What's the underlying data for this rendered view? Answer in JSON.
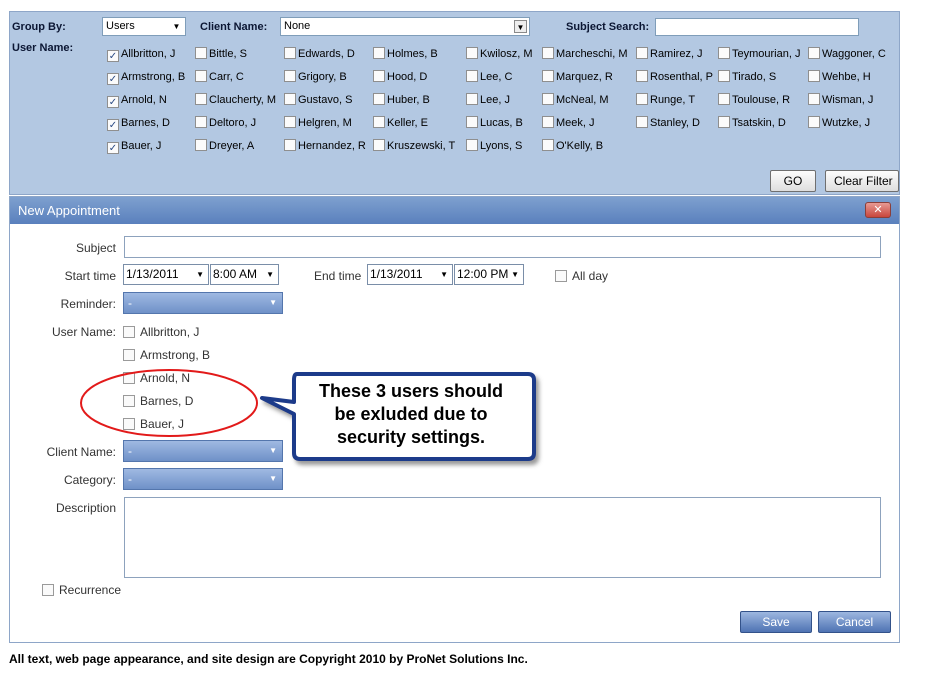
{
  "filter": {
    "group_by_label": "Group By:",
    "group_by_value": "Users",
    "client_name_label": "Client Name:",
    "client_name_value": "None",
    "subject_search_label": "Subject Search:",
    "subject_search_value": "",
    "user_name_label": "User Name:",
    "go_label": "GO",
    "clear_label": "Clear Filter",
    "users": [
      {
        "name": "Allbritton, J",
        "checked": true
      },
      {
        "name": "Armstrong, B",
        "checked": true
      },
      {
        "name": "Arnold, N",
        "checked": true
      },
      {
        "name": "Barnes, D",
        "checked": true
      },
      {
        "name": "Bauer, J",
        "checked": true
      },
      {
        "name": "Bittle, S",
        "checked": false
      },
      {
        "name": "Carr, C",
        "checked": false
      },
      {
        "name": "Claucherty, M",
        "checked": false
      },
      {
        "name": "Deltoro, J",
        "checked": false
      },
      {
        "name": "Dreyer, A",
        "checked": false
      },
      {
        "name": "Edwards, D",
        "checked": false
      },
      {
        "name": "Grigory, B",
        "checked": false
      },
      {
        "name": "Gustavo, S",
        "checked": false
      },
      {
        "name": "Helgren, M",
        "checked": false
      },
      {
        "name": "Hernandez, R",
        "checked": false
      },
      {
        "name": "Holmes, B",
        "checked": false
      },
      {
        "name": "Hood, D",
        "checked": false
      },
      {
        "name": "Huber, B",
        "checked": false
      },
      {
        "name": "Keller, E",
        "checked": false
      },
      {
        "name": "Kruszewski, T",
        "checked": false
      },
      {
        "name": "Kwilosz, M",
        "checked": false
      },
      {
        "name": "Lee, C",
        "checked": false
      },
      {
        "name": "Lee, J",
        "checked": false
      },
      {
        "name": "Lucas, B",
        "checked": false
      },
      {
        "name": "Lyons, S",
        "checked": false
      },
      {
        "name": "Marcheschi, M",
        "checked": false
      },
      {
        "name": "Marquez, R",
        "checked": false
      },
      {
        "name": "McNeal, M",
        "checked": false
      },
      {
        "name": "Meek, J",
        "checked": false
      },
      {
        "name": "O'Kelly, B",
        "checked": false
      },
      {
        "name": "Ramirez, J",
        "checked": false
      },
      {
        "name": "Rosenthal, P",
        "checked": false
      },
      {
        "name": "Runge, T",
        "checked": false
      },
      {
        "name": "Stanley, D",
        "checked": false
      },
      {
        "name": "Teymourian, J",
        "checked": false
      },
      {
        "name": "Tirado, S",
        "checked": false
      },
      {
        "name": "Toulouse, R",
        "checked": false
      },
      {
        "name": "Tsatskin, D",
        "checked": false
      },
      {
        "name": "Waggoner, C",
        "checked": false
      },
      {
        "name": "Wehbe, H",
        "checked": false
      },
      {
        "name": "Wisman, J",
        "checked": false
      },
      {
        "name": "Wutzke, J",
        "checked": false
      }
    ]
  },
  "dialog": {
    "title": "New Appointment",
    "close_icon": "close-x",
    "subject_label": "Subject",
    "subject_value": "",
    "start_time_label": "Start time",
    "start_date": "1/13/2011",
    "start_time": "8:00 AM",
    "end_time_label": "End time",
    "end_date": "1/13/2011",
    "end_time": "12:00 PM",
    "all_day_label": "All day",
    "reminder_label": "Reminder:",
    "reminder_value": "-",
    "user_name_label": "User Name:",
    "users": [
      "Allbritton, J",
      "Armstrong, B",
      "Arnold, N",
      "Barnes, D",
      "Bauer, J"
    ],
    "client_name_label": "Client Name:",
    "client_name_value": "-",
    "category_label": "Category:",
    "category_value": "-",
    "description_label": "Description",
    "recurrence_label": "Recurrence",
    "save_label": "Save",
    "cancel_label": "Cancel"
  },
  "annotation": {
    "callout_lines": [
      "These 3 users should",
      "be exluded due to",
      "security settings."
    ],
    "highlight_color": "#e21a1a",
    "callout_border_color": "#1f3a8a"
  },
  "footer": {
    "copyright": "All text, web page appearance, and site design are Copyright 2010 by ProNet Solutions Inc."
  }
}
